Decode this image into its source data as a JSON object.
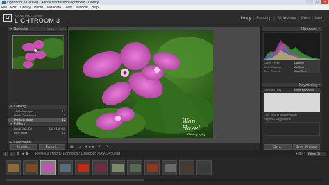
{
  "window": {
    "title": "Lightroom 3 Catalog - Adobe Photoshop Lightroom - Library",
    "minimize": "_",
    "maximize": "□",
    "close": "×"
  },
  "menu": [
    "File",
    "Edit",
    "Library",
    "Photo",
    "Metadata",
    "View",
    "Window",
    "Help"
  ],
  "identity": {
    "logo": "Lr",
    "brand_small": "ADOBE PHOTOSHOP",
    "brand_big": "LIGHTROOM 3",
    "modules": [
      "Library",
      "Develop",
      "Slideshow",
      "Print",
      "Web"
    ],
    "active_module": "Library"
  },
  "left_panel": {
    "navigator_title": "Navigator",
    "navigator_opts": "FIT  FILL  1:1  3:1",
    "catalog_title": "Catalog",
    "catalog_rows": [
      {
        "label": "All Photographs",
        "count": "12"
      },
      {
        "label": "Quick Collection +",
        "count": "0"
      },
      {
        "label": "Previous Import",
        "count": "12"
      }
    ],
    "folders_title": "Folders",
    "folder_rows": [
      {
        "label": "Local Disk (D:)",
        "count": "132 / 149 GB"
      },
      {
        "label": "sony alpha",
        "count": "12"
      }
    ],
    "collections_title": "Collections",
    "import_button": "Import...",
    "export_button": "Export..."
  },
  "photo": {
    "watermark_line1": "Wan Hazel",
    "watermark_line2": "Photography"
  },
  "toolbar": {
    "grid_icon": "▦",
    "loupe_icon": "▭",
    "stars": "★★★",
    "rotate_left": "↶",
    "rotate_right": "↷"
  },
  "right_panel": {
    "histogram_title": "Histogram",
    "histogram_rows": [
      {
        "label": "Saved Preset",
        "value": "Custom"
      },
      {
        "label": "White Balance",
        "value": "As Shot"
      },
      {
        "label": "Tone Control",
        "value": "Auto Tone"
      }
    ],
    "keywording_title": "Keywording",
    "keyword_tags_label": "Keyword Tags",
    "keyword_tags_value": "Enter Keywords",
    "click_hint": "Click here to add keywords",
    "suggestions_label": "Keyword Suggestions",
    "sync_button": "Sync",
    "sync_settings_button": "Sync Settings"
  },
  "filmbar": {
    "pages": [
      "1",
      "2"
    ],
    "nav_back": "◀",
    "nav_fwd": "▶",
    "source": "Previous Import / 12 photos / 1 selected / DSC3450.jpg",
    "filter_label": "Filter:",
    "filter_value": "Filters Off"
  },
  "filmstrip": {
    "count": 12,
    "selected_index": 2,
    "thumb_colors": [
      "#8a6a3a",
      "#7a4a20",
      "#c055b0",
      "#5a6a7a",
      "#c02a1a",
      "#6a3040",
      "#7a8a6a",
      "#556a55",
      "#8a3a20",
      "#6a6a6a",
      "#4a3a2a",
      "#3a3a3a"
    ]
  },
  "colors": {
    "accent_magenta": "#c94fb2",
    "leaf_green": "#3f7a2a",
    "panel_bg": "#2e2e2e"
  }
}
